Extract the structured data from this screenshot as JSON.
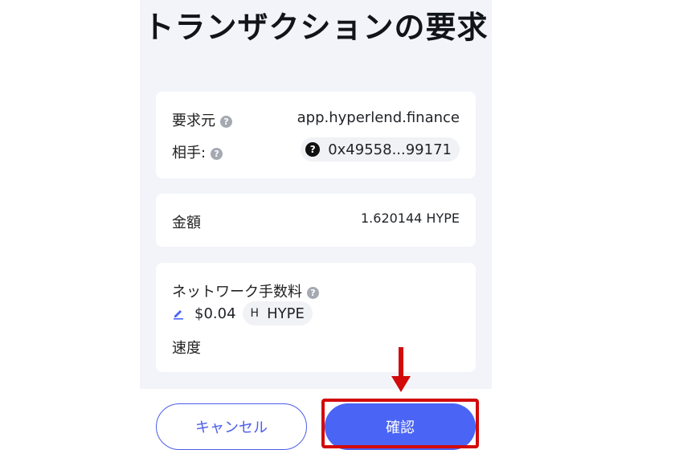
{
  "title": "トランザクションの要求",
  "request": {
    "origin_label": "要求元",
    "origin_value": "app.hyperlend.finance",
    "counterparty_label": "相手:",
    "counterparty_value": "0x49558...99171"
  },
  "amount": {
    "label": "金額",
    "value": "1.620144 HYPE"
  },
  "fee": {
    "label": "ネットワーク手数料",
    "value": "$0.04",
    "token_letter": "H",
    "token": "HYPE",
    "speed_label": "速度"
  },
  "buttons": {
    "cancel": "キャンセル",
    "confirm": "確認"
  },
  "colors": {
    "accent": "#4a64f5",
    "highlight": "#d20a0a"
  }
}
